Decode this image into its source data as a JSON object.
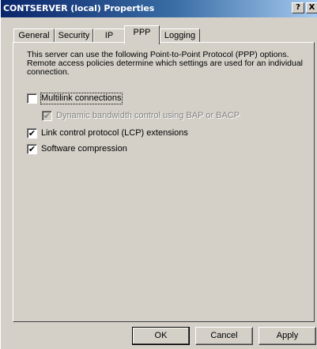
{
  "window": {
    "title": "CONTSERVER (local) Properties",
    "help_label": "?",
    "close_label": "X"
  },
  "tabs": [
    {
      "label": "General",
      "active": false
    },
    {
      "label": "Security",
      "active": false
    },
    {
      "label": "IP",
      "active": false
    },
    {
      "label": "PPP",
      "active": true
    },
    {
      "label": "Logging",
      "active": false
    }
  ],
  "panel": {
    "description": "This server can use the following Point-to-Point Protocol (PPP) options. Remote access policies determine which settings are used for an individual connection.",
    "options": [
      {
        "label": "Multilink connections",
        "checked": false,
        "enabled": true
      },
      {
        "label": "Dynamic bandwidth control using BAP or BACP",
        "checked": true,
        "enabled": false
      },
      {
        "label": "Link control protocol (LCP) extensions",
        "checked": true,
        "enabled": true
      },
      {
        "label": "Software compression",
        "checked": true,
        "enabled": true
      }
    ]
  },
  "buttons": {
    "ok": "OK",
    "cancel": "Cancel",
    "apply": "Apply"
  },
  "colors": {
    "title_start": "#0a246a",
    "title_end": "#a6caf0",
    "face": "#d4d0c8"
  }
}
